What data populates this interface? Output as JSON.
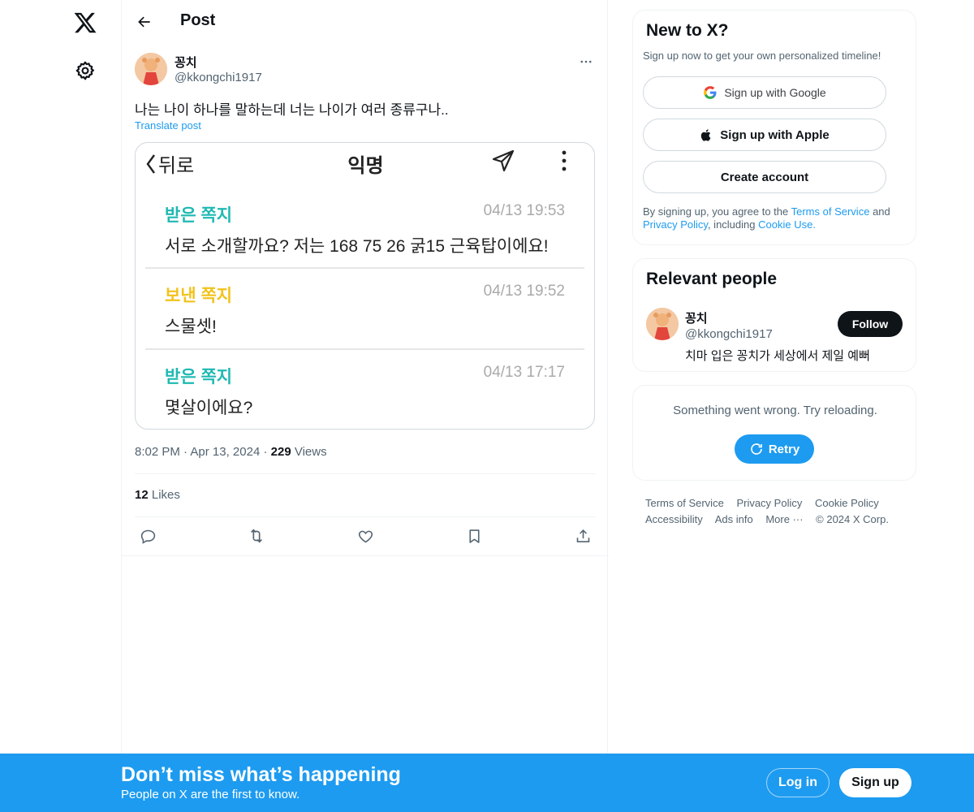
{
  "nav": {
    "logo_icon": "x-logo-icon",
    "settings_icon": "gear-icon"
  },
  "header": {
    "title": "Post",
    "back_icon": "arrow-left-icon"
  },
  "post": {
    "author_name": "꽁치",
    "author_handle": "@kkongchi1917",
    "text": "나는 나이 하나를 말하는데 너는 나이가 여러 종류구나..",
    "translate_label": "Translate post",
    "image": {
      "back_label": "뒤로",
      "title": "익명",
      "messages": [
        {
          "kind": "받은 쪽지",
          "kind_color": "#1fb9b3",
          "time": "04/13 19:53",
          "body": "서로 소개할까요? 저는 168 75 26 굵15 근육탑이에요!"
        },
        {
          "kind": "보낸 쪽지",
          "kind_color": "#f2c21b",
          "time": "04/13 19:52",
          "body": "스물셋!"
        },
        {
          "kind": "받은 쪽지",
          "kind_color": "#1fb9b3",
          "time": "04/13 17:17",
          "body": "몇살이에요?"
        }
      ]
    },
    "time": "8:02 PM",
    "date": "Apr 13, 2024",
    "views_count": "229",
    "views_label": "Views",
    "likes_count": "12",
    "likes_label": "Likes",
    "actions": [
      "reply-icon",
      "repost-icon",
      "like-icon",
      "bookmark-icon",
      "share-icon"
    ]
  },
  "new_to_x": {
    "title": "New to X?",
    "subtitle": "Sign up now to get your own personalized timeline!",
    "google_label": "Sign up with Google",
    "apple_label": "Sign up with Apple",
    "create_label": "Create account",
    "legal_prefix": "By signing up, you agree to the",
    "terms_link": "Terms of Service",
    "legal_and": "and",
    "privacy_link": "Privacy Policy",
    "legal_including": ", including",
    "cookie_link": "Cookie Use."
  },
  "relevant": {
    "title": "Relevant people",
    "name": "꽁치",
    "handle": "@kkongchi1917",
    "bio": "치마 입은 꽁치가 세상에서 제일 예뻐",
    "follow_label": "Follow"
  },
  "error": {
    "message": "Something went wrong. Try reloading.",
    "retry_label": "Retry"
  },
  "footer": {
    "terms": "Terms of Service",
    "privacy": "Privacy Policy",
    "cookie": "Cookie Policy",
    "accessibility": "Accessibility",
    "ads": "Ads info",
    "more": "More ···",
    "copyright": "© 2024 X Corp."
  },
  "banner": {
    "title": "Don’t miss what’s happening",
    "subtitle": "People on X are the first to know.",
    "login_label": "Log in",
    "signup_label": "Sign up"
  },
  "colors": {
    "accent": "#1d9bf0",
    "text": "#0f1419",
    "muted": "#536471",
    "border": "#eff3f4"
  }
}
